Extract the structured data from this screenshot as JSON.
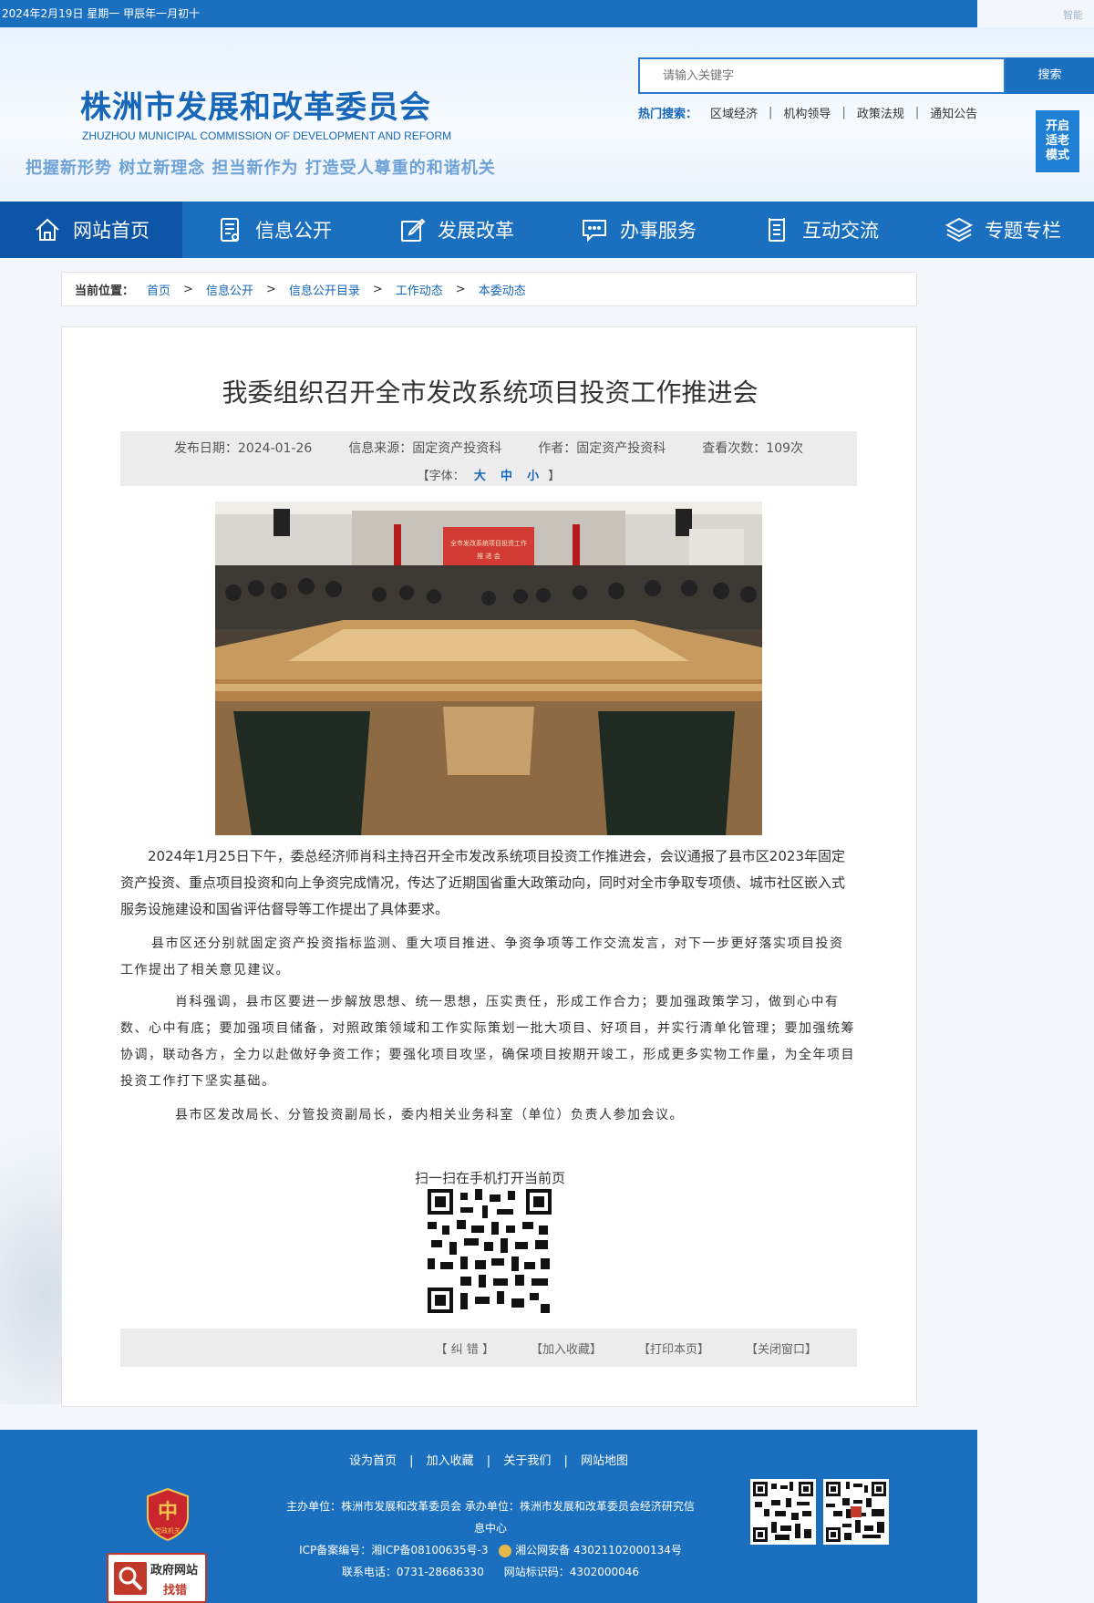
{
  "topbar": {
    "date_text": "2024年2月19日   星期一   甲辰年一月初十",
    "right_text": "智能"
  },
  "header": {
    "site_title": "株洲市发展和改革委员会",
    "site_title_en": "ZHUZHOU MUNICIPAL COMMISSION OF DEVELOPMENT AND REFORM",
    "slogan": "把握新形势 树立新理念 担当新作为 打造受人尊重的和谐机关",
    "search": {
      "placeholder": "请输入关键字",
      "button_label": "搜索"
    },
    "hot_search": {
      "label": "热门搜索：",
      "items": [
        "区域经济",
        "机构领导",
        "政策法规",
        "通知公告"
      ]
    },
    "elder_mode": [
      "开启",
      "适老",
      "模式"
    ]
  },
  "nav": {
    "items": [
      {
        "label": "网站首页",
        "icon": "home-icon"
      },
      {
        "label": "信息公开",
        "icon": "document-list-icon"
      },
      {
        "label": "发展改革",
        "icon": "edit-icon"
      },
      {
        "label": "办事服务",
        "icon": "chat-icon"
      },
      {
        "label": "互动交流",
        "icon": "notepad-icon"
      },
      {
        "label": "专题专栏",
        "icon": "layers-icon"
      }
    ]
  },
  "breadcrumb": {
    "label": "当前位置：",
    "items": [
      "首页",
      "信息公开",
      "信息公开目录",
      "工作动态",
      "本委动态"
    ]
  },
  "article": {
    "title": "我委组织召开全市发改系统项目投资工作推进会",
    "meta": {
      "date": "发布日期：2024-01-26",
      "source": "信息来源：固定资产投资科",
      "author": "作者：固定资产投资科",
      "views": "查看次数：109次"
    },
    "font_label_open": "【字体：",
    "font_sizes": [
      "大",
      "中",
      "小"
    ],
    "font_label_close": "】",
    "paragraphs": [
      "2024年1月25日下午，委总经济师肖科主持召开全市发改系统项目投资工作推进会，会议通报了县市区2023年固定资产投资、重点项目投资和向上争资完成情况，传达了近期国省重大政策动向，同时对全市争取专项债、城市社区嵌入式服务设施建设和国省评估督导等工作提出了具体要求。",
      "县市区还分别就固定资产投资指标监测、重大项目推进、争资争项等工作交流发言，对下一步更好落实项目投资工作提出了相关意见建议。",
      "肖科强调，县市区要进一步解放思想、统一思想，压实责任，形成工作合力；要加强政策学习，做到心中有数、心中有底；要加强项目储备，对照政策领域和工作实际策划一批大项目、好项目，并实行清单化管理；要加强统筹协调，联动各方，全力以赴做好争资工作；要强化项目攻坚，确保项目按期开竣工，形成更多实物工作量，为全年项目投资工作打下坚实基础。",
      "县市区发改局长、分管投资副局长，委内相关业务科室（单位）负责人参加会议。"
    ],
    "photo_banner": [
      "全市发改系统项目投资工作",
      "推 进 会"
    ],
    "qr_caption": "扫一扫在手机打开当前页",
    "actions": [
      "【 纠 错 】",
      "【加入收藏】",
      "【打印本页】",
      "【关闭窗口】"
    ]
  },
  "footer": {
    "links": [
      "设为首页",
      "加入收藏",
      "关于我们",
      "网站地图"
    ],
    "host_line": "主办单位：株洲市发展和改革委员会 承办单位：株洲市发展和改革委员会经济研究信息中心",
    "icp": "ICP备案编号：湘ICP备08100635号-3",
    "police": "湘公网安备 43021102000134号",
    "phone": "联系电话：0731-28686330",
    "site_code": "网站标识码：4302000046",
    "badge_dj": "党政机关",
    "badge_zc": [
      "政府网站",
      "找错"
    ]
  },
  "colors": {
    "primary": "#1a6fbf",
    "nav_active": "#0d55a6",
    "link": "#1766b7"
  }
}
